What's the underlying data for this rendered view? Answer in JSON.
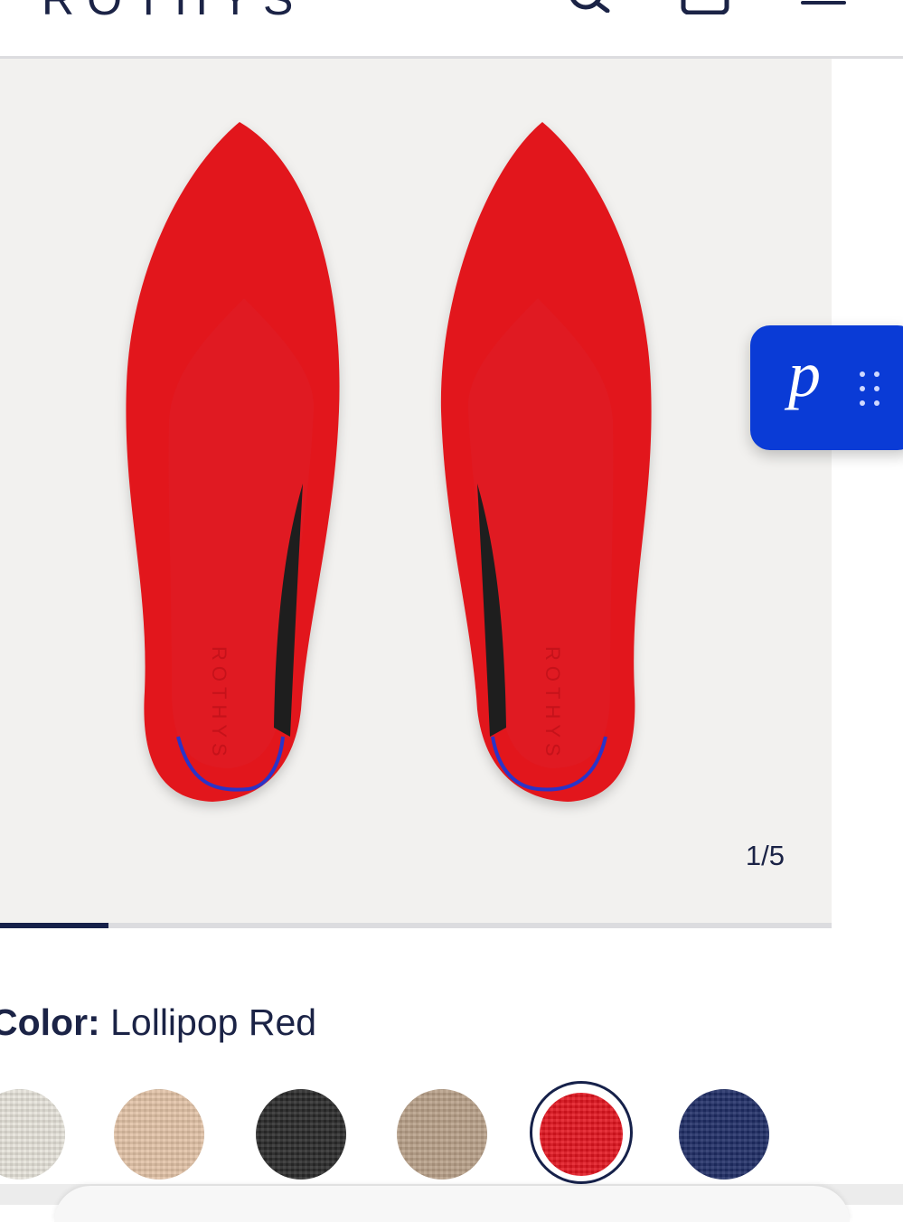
{
  "header": {
    "logo": "ROTHYS",
    "icons": [
      "search-icon",
      "bag-icon",
      "menu-icon"
    ]
  },
  "gallery": {
    "counter": "1/5",
    "current_index": 1,
    "total_images": 5,
    "progress_fraction": 0.2,
    "insole_brand": "ROTHYS",
    "shoe_color": "#e2161c",
    "piping_color": "#2a34c8"
  },
  "widget": {
    "letter": "p",
    "background": "#0a3bd6"
  },
  "color_selector": {
    "label": "Color:",
    "selected": "Lollipop Red",
    "swatches": [
      {
        "name": "cream",
        "color": "#e6e3da"
      },
      {
        "name": "beige",
        "color": "#e2c3a6"
      },
      {
        "name": "black",
        "color": "#2a2a2a"
      },
      {
        "name": "taupe",
        "color": "#b8a088"
      },
      {
        "name": "lollipop-red",
        "color": "#e3141f",
        "selected": true
      },
      {
        "name": "navy",
        "color": "#1f2d66"
      }
    ]
  }
}
